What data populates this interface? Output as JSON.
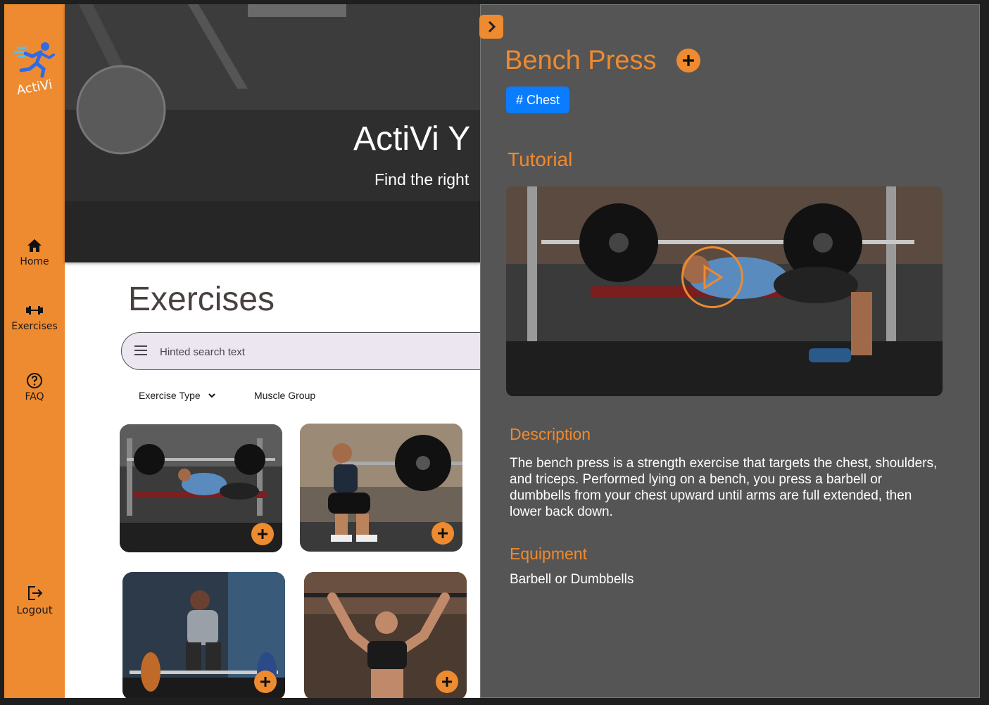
{
  "app": {
    "name": "ActiVi"
  },
  "sidebar": {
    "items": [
      {
        "label": "Home",
        "icon": "home-icon"
      },
      {
        "label": "Exercises",
        "icon": "dumbbell-icon"
      },
      {
        "label": "FAQ",
        "icon": "help-icon"
      },
      {
        "label": "Logout",
        "icon": "logout-icon"
      }
    ]
  },
  "hero": {
    "title": "ActiVi Y",
    "subtitle": "Find the right"
  },
  "main": {
    "title": "Exercises",
    "search_placeholder": "Hinted search text",
    "filters": {
      "type": "Exercise Type",
      "muscle": "Muscle Group"
    },
    "cards": [
      {
        "scene": "bench-press"
      },
      {
        "scene": "squat"
      },
      {
        "scene": "deadlift"
      },
      {
        "scene": "overhead-press"
      }
    ]
  },
  "panel": {
    "title": "Bench Press",
    "tag": "# Chest",
    "tutorial_heading": "Tutorial",
    "description_heading": "Description",
    "description": "The bench press is a strength exercise that targets the chest, shoulders, and triceps. Performed lying on a bench, you press a barbell or dumbbells from your chest upward until arms are full extended, then lower back down.",
    "equipment_heading": "Equipment",
    "equipment": "Barbell or Dumbbells"
  },
  "colors": {
    "accent": "#EE8A30",
    "panel_bg": "#555555",
    "tag_blue": "#0A7CFF",
    "search_bg": "#ECE6F0"
  }
}
